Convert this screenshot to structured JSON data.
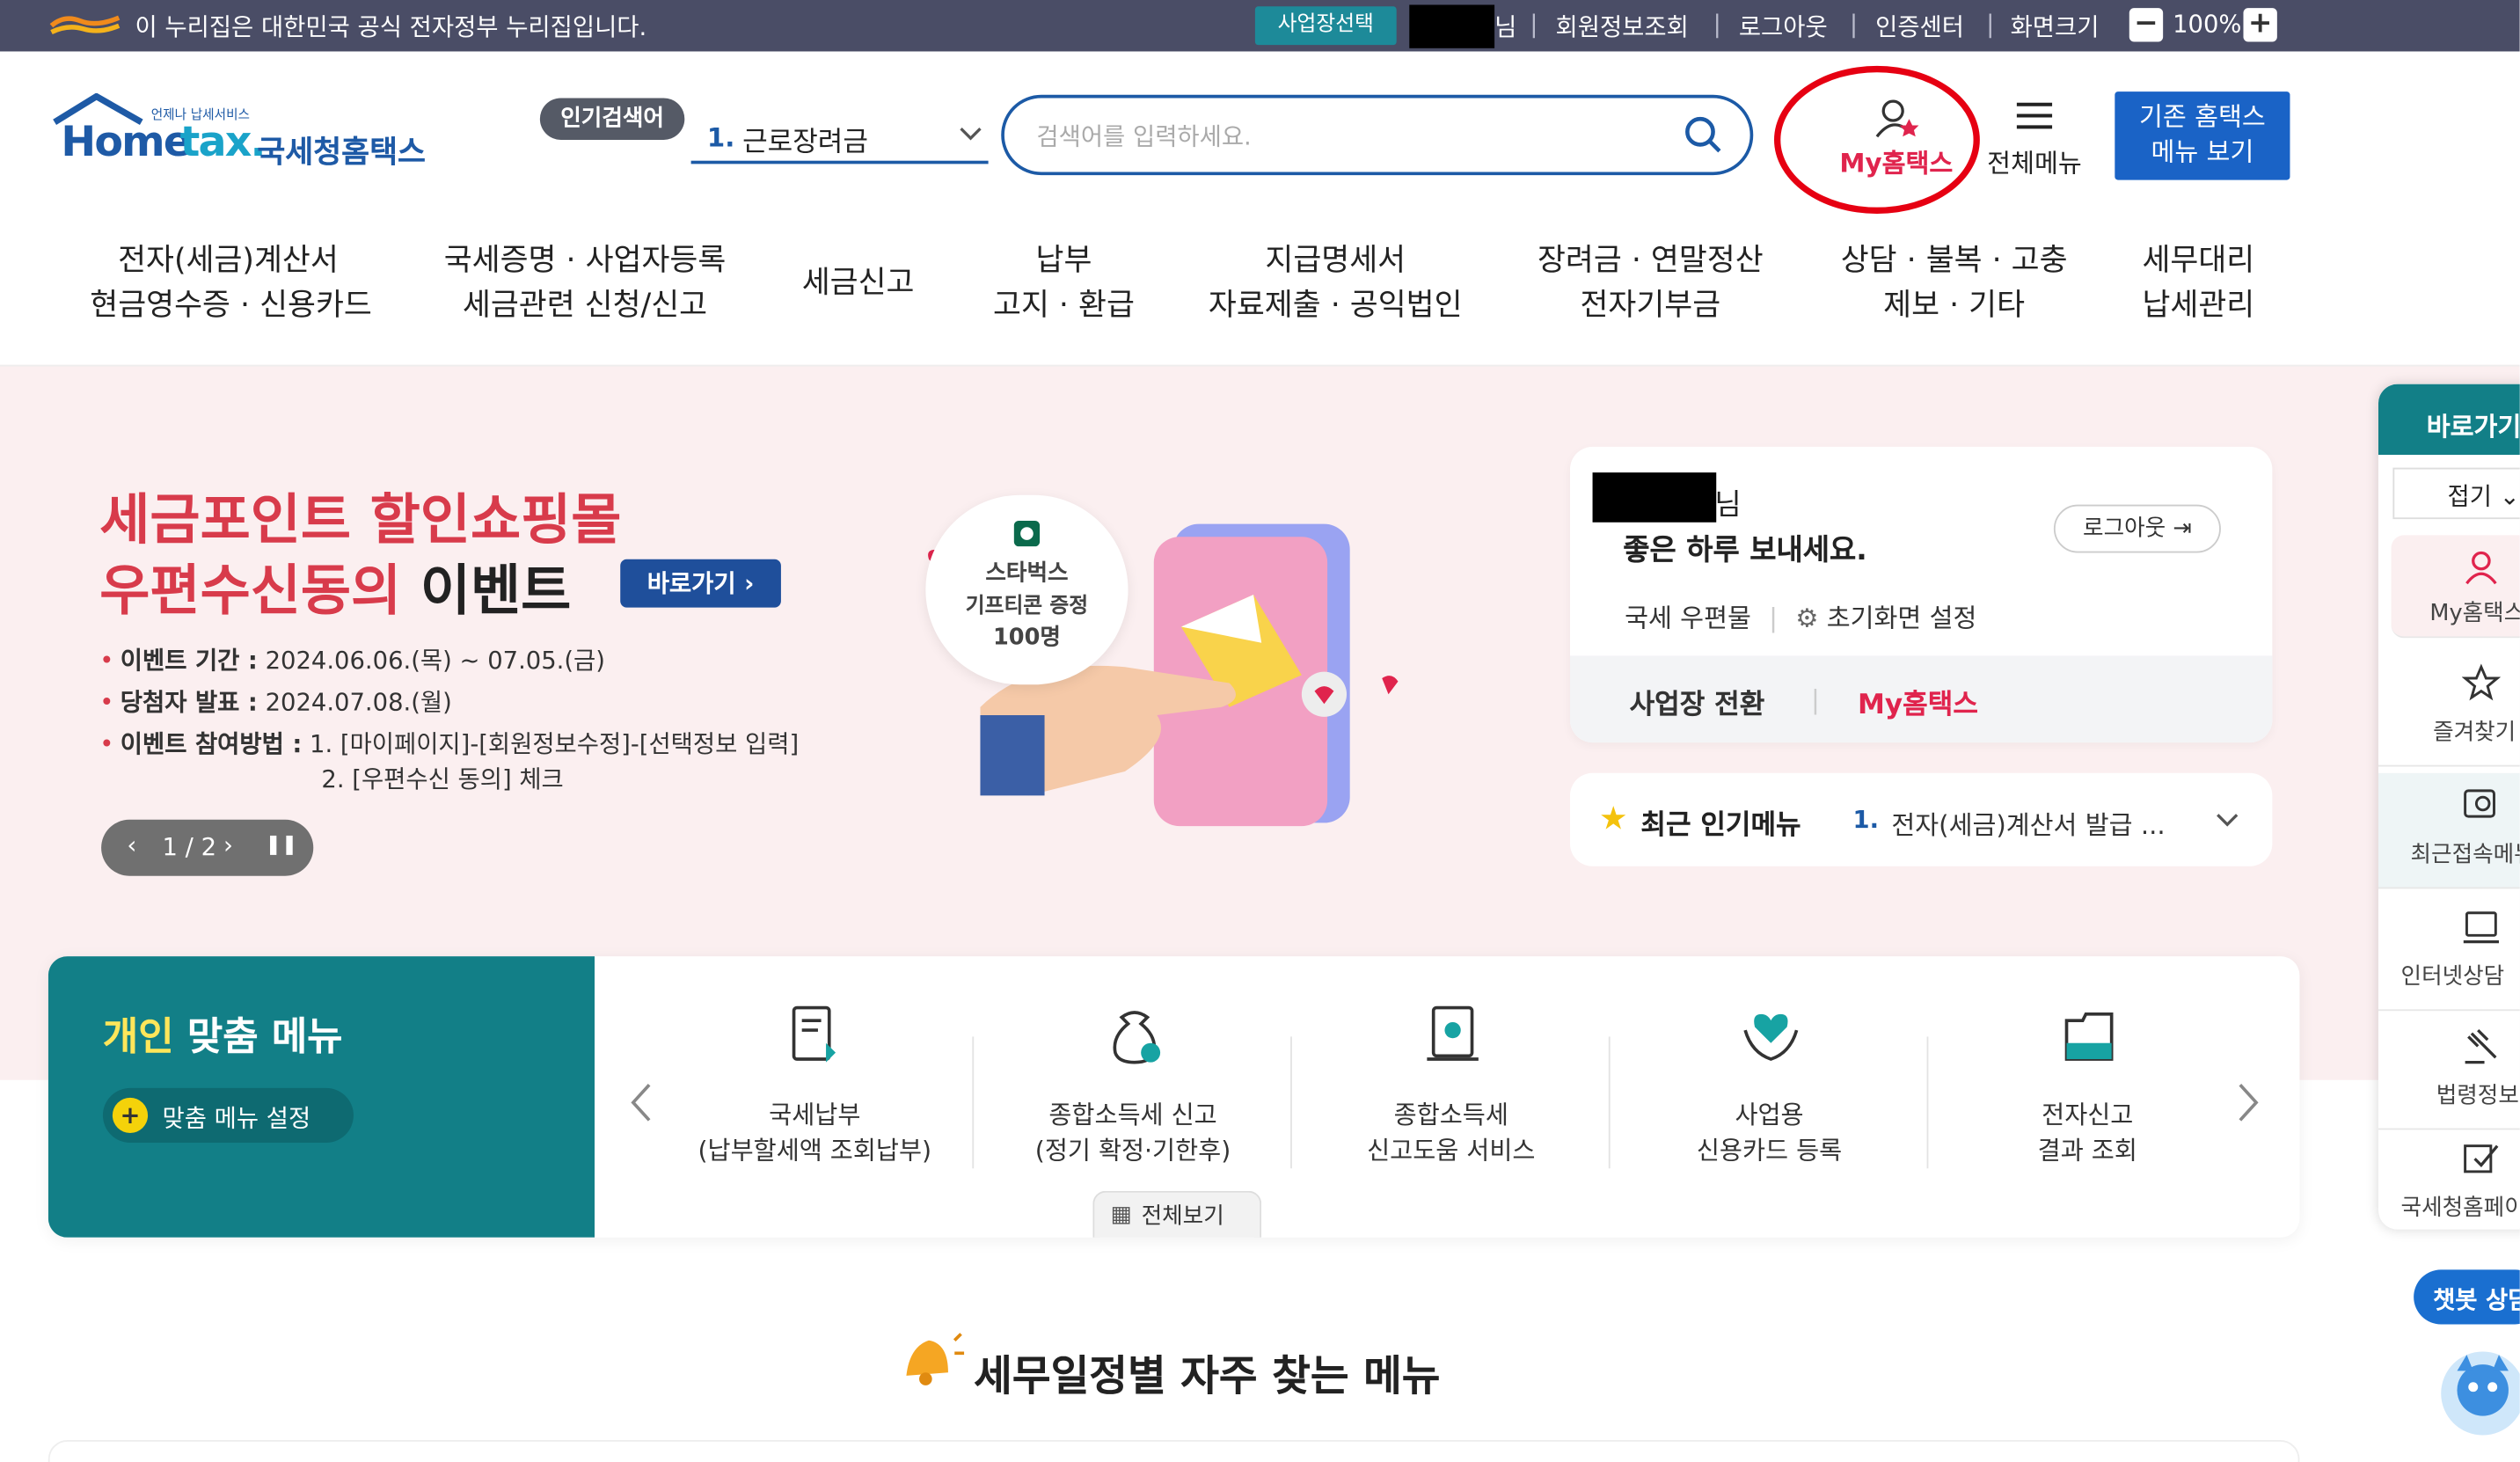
{
  "govbar": {
    "notice": "이 누리집은 대한민국 공식 전자정부 누리집입니다.",
    "biz_select": "사업장선택",
    "user_suffix": "님",
    "links": [
      "회원정보조회",
      "로그아웃",
      "인증센터",
      "화면크기"
    ],
    "zoom": "100%",
    "zoom_out": "−",
    "zoom_in": "+"
  },
  "header": {
    "logo_tag": "언제나 납세서비스",
    "logo_en_home": "Home",
    "logo_en_tax": "tax.",
    "logo_kr": "국세청홈택스",
    "popular_badge": "인기검색어",
    "popular_num": "1.",
    "popular_text": "근로장려금",
    "search_placeholder": "검색어를 입력하세요.",
    "my_hometax": "My홈택스",
    "all_menu": "전체메뉴",
    "old_menu_line1": "기존 홈택스",
    "old_menu_line2": "메뉴 보기"
  },
  "gnb": [
    {
      "l1": "전자(세금)계산서",
      "l2": "현금영수증 · 신용카드"
    },
    {
      "l1": "국세증명 · 사업자등록",
      "l2": "세금관련 신청/신고"
    },
    {
      "l1": "세금신고",
      "l2": ""
    },
    {
      "l1": "납부",
      "l2": "고지 · 환급"
    },
    {
      "l1": "지급명세서",
      "l2": "자료제출 · 공익법인"
    },
    {
      "l1": "장려금 · 연말정산",
      "l2": "전자기부금"
    },
    {
      "l1": "상담 · 불복 · 고충",
      "l2": "제보 · 기타"
    },
    {
      "l1": "세무대리",
      "l2": "납세관리"
    }
  ],
  "banner": {
    "title_line1": "세금포인트 할인쇼핑몰",
    "title_line2a": "우편수신동의 ",
    "title_line2b": "이벤트",
    "go_button": "바로가기 ›",
    "period_label": "이벤트 기간 :",
    "period_value": " 2024.06.06.(목) ~ 07.05.(금)",
    "winner_label": "당첨자 발표 :",
    "winner_value": " 2024.07.08.(월)",
    "method_label": "이벤트 참여방법 :",
    "method_value1": " 1. [마이페이지]-[회원정보수정]-[선택정보 입력]",
    "method_value2": "2. [우편수신 동의] 체크",
    "pager": "1 / 2",
    "bubble_l1": "스타벅스",
    "bubble_l2": "기프티콘 증정",
    "bubble_l3": "100명",
    "colors": {
      "title": "#d83b4b",
      "button": "#1f4f9b",
      "background": "#fbeff0"
    }
  },
  "login": {
    "name_suffix": "님",
    "greeting": "좋은 하루 보내세요.",
    "logout": "로그아웃",
    "mail": "국세 우편물",
    "settings": "초기화면 설정",
    "switch_biz": "사업장 전환",
    "my_hometax": "My홈택스"
  },
  "recent_popular": {
    "label": "최근 인기메뉴",
    "num": "1.",
    "item": "전자(세금)계산서 발급 ..."
  },
  "personal_menu": {
    "title_accent": "개인",
    "title_rest": " 맞춤 메뉴",
    "settings": "맞춤 메뉴 설정",
    "items": [
      {
        "l1": "국세납부",
        "l2": "(납부할세액 조회납부)",
        "icon": "tax-payment-icon"
      },
      {
        "l1": "종합소득세 신고",
        "l2": "(정기 확정·기한후)",
        "icon": "money-bag-icon"
      },
      {
        "l1": "종합소득세",
        "l2": "신고도움 서비스",
        "icon": "document-help-icon"
      },
      {
        "l1": "사업용",
        "l2": "신용카드 등록",
        "icon": "heart-hands-icon"
      },
      {
        "l1": "전자신고",
        "l2": "결과 조회",
        "icon": "folder-result-icon"
      }
    ],
    "view_all": "전체보기"
  },
  "section": {
    "title": "세무일정별 자주 찾는 메뉴"
  },
  "quick": {
    "title": "바로가기",
    "fold": "접기",
    "items": [
      {
        "label": "My홈택스",
        "icon": "person-icon"
      },
      {
        "label": "즐겨찾기",
        "icon": "star-icon"
      },
      {
        "label": "최근접속메뉴",
        "icon": "recent-search-icon"
      },
      {
        "label": "인터넷상담",
        "icon": "laptop-icon"
      },
      {
        "label": "법령정보",
        "icon": "gavel-icon"
      },
      {
        "label": "국세청홈페이지",
        "icon": "edit-icon"
      }
    ]
  },
  "chatbot": {
    "label": "챗봇 상담"
  },
  "colors": {
    "govbar": "#4a4d66",
    "brand_blue": "#1c5aa6",
    "teal": "#127f87",
    "my_hometax": "#e0244d",
    "highlight_circle": "#e60012"
  }
}
